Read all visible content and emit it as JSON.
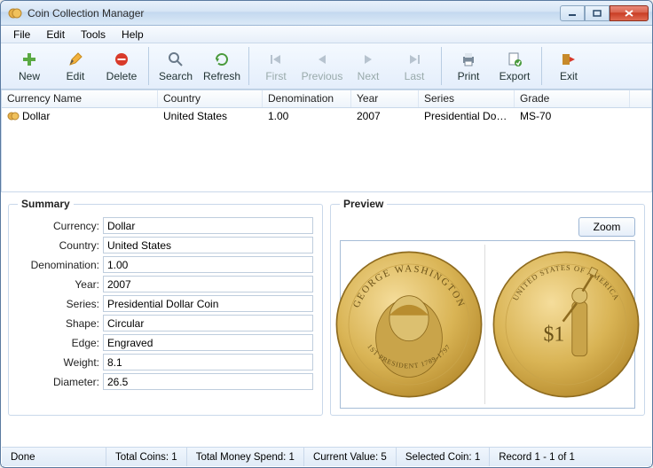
{
  "window": {
    "title": "Coin Collection Manager"
  },
  "menu": {
    "file": "File",
    "edit": "Edit",
    "tools": "Tools",
    "help": "Help"
  },
  "toolbar": {
    "new": "New",
    "edit": "Edit",
    "delete": "Delete",
    "search": "Search",
    "refresh": "Refresh",
    "first": "First",
    "previous": "Previous",
    "next": "Next",
    "last": "Last",
    "print": "Print",
    "export": "Export",
    "exit": "Exit"
  },
  "table": {
    "headers": {
      "currency_name": "Currency Name",
      "country": "Country",
      "denomination": "Denomination",
      "year": "Year",
      "series": "Series",
      "grade": "Grade"
    },
    "rows": [
      {
        "currency_name": "Dollar",
        "country": "United States",
        "denomination": "1.00",
        "year": "2007",
        "series": "Presidential Doll...",
        "grade": "MS-70"
      }
    ]
  },
  "summary": {
    "title": "Summary",
    "labels": {
      "currency": "Currency:",
      "country": "Country:",
      "denomination": "Denomination:",
      "year": "Year:",
      "series": "Series:",
      "shape": "Shape:",
      "edge": "Edge:",
      "weight": "Weight:",
      "diameter": "Diameter:"
    },
    "values": {
      "currency": "Dollar",
      "country": "United States",
      "denomination": "1.00",
      "year": "2007",
      "series": "Presidential Dollar Coin",
      "shape": "Circular",
      "edge": "Engraved",
      "weight": "8.1",
      "diameter": "26.5"
    }
  },
  "preview": {
    "title": "Preview",
    "zoom": "Zoom",
    "obverse": {
      "top": "GEORGE WASHINGTON",
      "bottom1": "1ST PRESIDENT",
      "bottom2": "1789-1797"
    },
    "reverse": {
      "top": "UNITED STATES OF AMERICA",
      "denom": "$1"
    }
  },
  "status": {
    "done": "Done",
    "total_coins": "Total Coins: 1",
    "total_money": "Total Money Spend: 1",
    "current_value": "Current Value: 5",
    "selected_coin": "Selected Coin: 1",
    "record": "Record 1 - 1 of 1"
  }
}
